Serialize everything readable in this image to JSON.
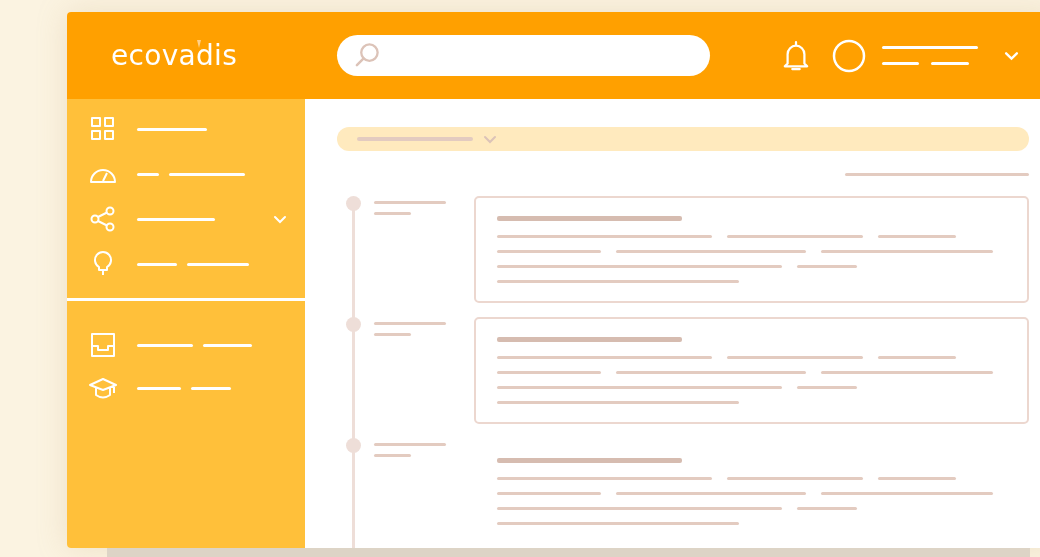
{
  "logo": {
    "text": "ecovadis"
  },
  "sidebar": {
    "groups": [
      {
        "items": [
          {
            "expandable": false
          },
          {
            "expandable": false
          },
          {
            "expandable": true
          },
          {
            "expandable": false
          }
        ]
      },
      {
        "items": [
          {
            "expandable": false
          },
          {
            "expandable": false
          }
        ]
      }
    ]
  },
  "timeline": {
    "entries": [
      {
        "boxed": true
      },
      {
        "boxed": true
      },
      {
        "boxed": false
      }
    ]
  }
}
